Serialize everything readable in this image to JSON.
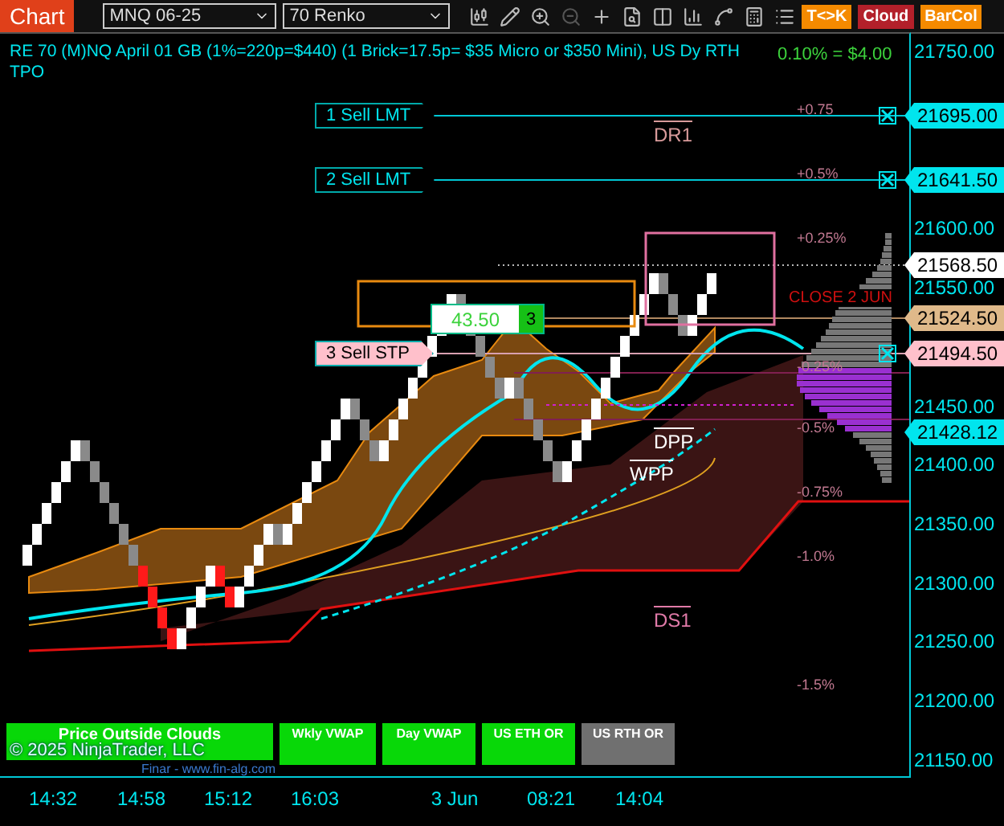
{
  "toolbar": {
    "title": "Chart",
    "instrument": "MNQ 06-25",
    "bar_type": "70 Renko",
    "tool_buttons": [
      {
        "label": "T<>K",
        "color": "#f58a00"
      },
      {
        "label": "Cloud",
        "color": "#b3202a"
      },
      {
        "label": "BarCol",
        "color": "#f58a00"
      }
    ]
  },
  "chart": {
    "title": "RE 70 (M)NQ April 01 GB (1%=220p=$440) (1 Brick=17.5p= $35 Micro or $350 Mini), US Dy RTH",
    "subtitle": "TPO",
    "tick_value": "0.10% = $4.00",
    "orders": [
      {
        "label": "1 Sell LMT",
        "kind": "limit"
      },
      {
        "label": "2 Sell LMT",
        "kind": "limit"
      },
      {
        "label": "3 Sell STP",
        "kind": "stop"
      }
    ],
    "position": {
      "pnl": "43.50",
      "quantity": "3"
    },
    "percent_levels": [
      "+0.75",
      "+0.5%",
      "+0.25%",
      "-0.25%",
      "-0.5%",
      "-0.75%",
      "-1.0%",
      "-1.5%"
    ],
    "close_label": "CLOSE 2 JUN",
    "pivots": [
      "DR1",
      "DPP",
      "WPP",
      "DS1"
    ],
    "indicators": [
      {
        "label": "Price Outside Clouds",
        "on": true
      },
      {
        "label": "Wkly VWAP",
        "on": true
      },
      {
        "label": "Day VWAP",
        "on": true
      },
      {
        "label": "US ETH OR",
        "on": true
      },
      {
        "label": "US RTH OR",
        "on": false
      }
    ],
    "copyright": "© 2025 NinjaTrader, LLC",
    "watermark": "Finar - www.fin-alg.com"
  },
  "price_axis": {
    "ticks": [
      "21750.00",
      "21600.00",
      "21550.00",
      "21450.00",
      "21400.00",
      "21350.00",
      "21300.00",
      "21250.00",
      "21200.00",
      "21150.00"
    ],
    "tags": [
      {
        "text": "21695.00",
        "color": "#00e5ee"
      },
      {
        "text": "21641.50",
        "color": "#00e5ee"
      },
      {
        "text": "21568.50",
        "color": "#ffffff"
      },
      {
        "text": "21524.50",
        "color": "#dfb98a"
      },
      {
        "text": "21494.50",
        "color": "#ffc0cb"
      },
      {
        "text": "21428.12",
        "color": "#00e5ee"
      }
    ]
  },
  "time_axis": [
    "14:32",
    "14:58",
    "15:12",
    "16:03",
    "3 Jun",
    "08:21",
    "14:04"
  ]
}
